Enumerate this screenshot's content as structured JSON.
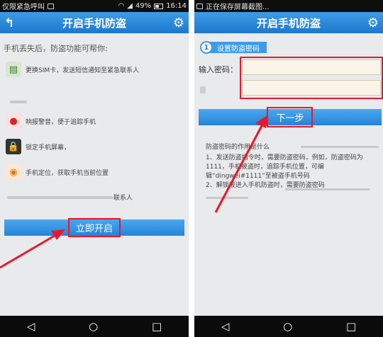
{
  "left": {
    "status": {
      "text": "仅限紧急呼叫",
      "battery": "49%",
      "time": "16:14"
    },
    "title": "开启手机防盗",
    "intro": "手机丢失后，防盗功能可帮你:",
    "features": [
      {
        "text": "更换SIM卡，发送短信通知至紧急联系人",
        "icon": "sim-card-icon"
      },
      {
        "text": "响报警音，便于追踪手机",
        "icon": "alarm-icon"
      },
      {
        "text": "锁定手机屏幕，",
        "icon": "lock-phone-icon"
      },
      {
        "text": "手机定位，获取手机当前位置",
        "icon": "location-icon"
      }
    ],
    "partial_text": "联系人",
    "start_button": "立即开启"
  },
  "right": {
    "status": {
      "text": "正在保存屏幕截图..."
    },
    "title": "开启手机防盗",
    "step_number": "1",
    "step_label": "设置防盗密码",
    "password_label": "输入密码：",
    "next_button": "下一步",
    "info_title": "防盗密码的作用是什么",
    "info_lines": [
      "1、发送防盗指令时，需要防盗密码，例如，防盗密码为",
      "1111，手机被盗时，追踪手机位置，可编",
      "辑“dingwei#1111”至被盗手机号码",
      "2、解锁被进入手机防盗时，需要防盗密码"
    ]
  },
  "colors": {
    "accent": "#2684d8",
    "highlight": "#e8182a"
  }
}
